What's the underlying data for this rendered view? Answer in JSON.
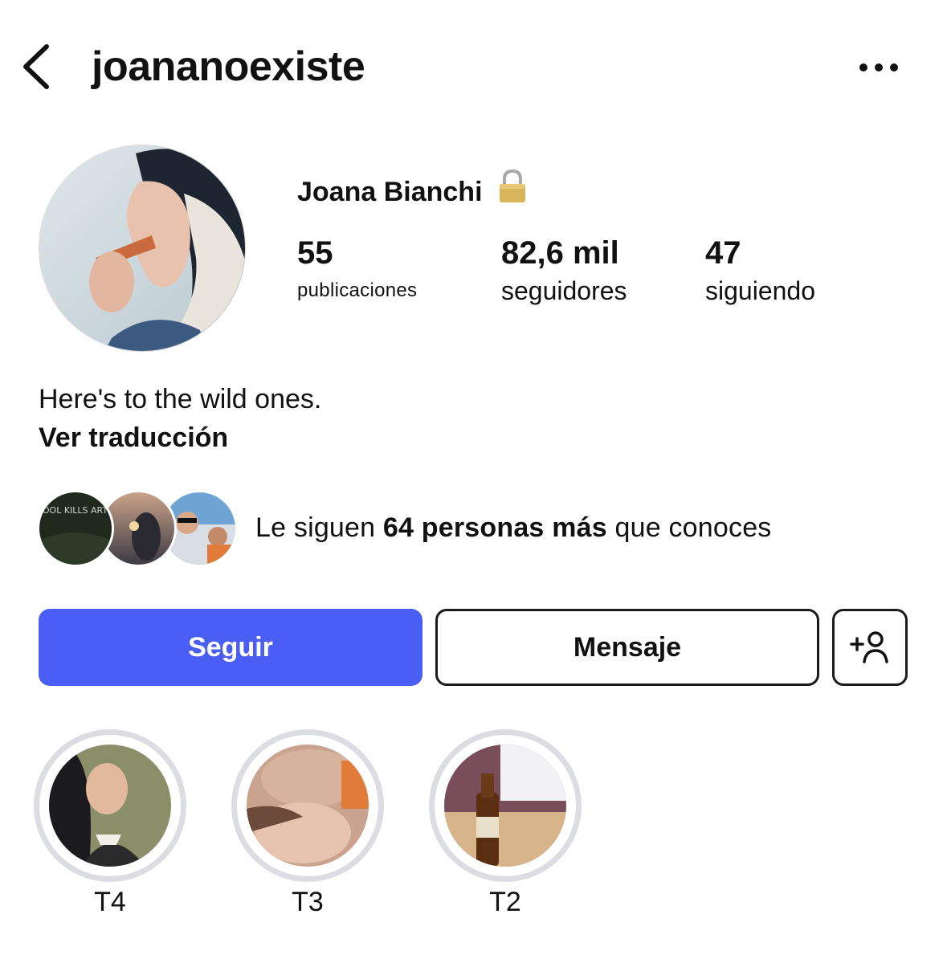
{
  "header": {
    "back_icon": "chevron-left-icon",
    "username": "joananoexiste",
    "more_icon": "more-horizontal-icon"
  },
  "profile": {
    "display_name": "Joana Bianchi",
    "badge_icon": "lock-icon",
    "stats": [
      {
        "value": "55",
        "label": "publicaciones"
      },
      {
        "value": "82,6 mil",
        "label": "seguidores"
      },
      {
        "value": "47",
        "label": "siguiendo"
      }
    ],
    "bio": "Here's to the wild ones.",
    "translate_label": "Ver traducción"
  },
  "mutual": {
    "prefix": "Le siguen ",
    "bold": "64 personas más",
    "suffix": " que conoces",
    "avatar_1_text": "SCHOOL KILLS ARTISTS"
  },
  "actions": {
    "follow_label": "Seguir",
    "message_label": "Mensaje",
    "suggest_icon": "add-person-icon"
  },
  "highlights": [
    {
      "label": "T4"
    },
    {
      "label": "T3"
    },
    {
      "label": "T2"
    }
  ],
  "colors": {
    "accent": "#4a5ef6",
    "highlight_ring": "#dcdde3",
    "text": "#111111"
  }
}
